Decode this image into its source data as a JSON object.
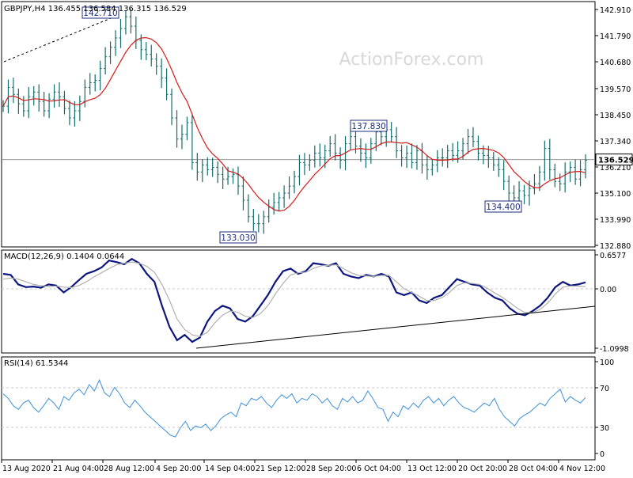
{
  "chart_data": [
    {
      "panel": "price",
      "type": "ohlc",
      "title": "GBPJPY,H4  136.455 136.584 136.315 136.529",
      "watermark": "ActionForex.com",
      "y_ticks": [
        "142.910",
        "141.790",
        "140.680",
        "139.570",
        "138.450",
        "137.340",
        "136.210",
        "135.100",
        "133.990",
        "132.880"
      ],
      "y_tick_values": [
        142.91,
        141.79,
        140.68,
        139.57,
        138.45,
        137.34,
        136.21,
        135.1,
        133.99,
        132.88
      ],
      "ylim": [
        132.88,
        142.91
      ],
      "current_price": 136.529,
      "current_price_label": "136.529",
      "annotations": [
        {
          "text": "142.710",
          "x": "28 Aug 2020",
          "y": 142.71
        },
        {
          "text": "133.030",
          "x": "21 Sep 2020",
          "y": 133.03
        },
        {
          "text": "137.830",
          "x": "6 Oct 2020",
          "y": 137.83
        },
        {
          "text": "134.400",
          "x": "29 Oct 2020",
          "y": 134.4
        }
      ],
      "series": [
        {
          "name": "price",
          "values": [
            138.8,
            139.6,
            139.3,
            138.9,
            138.6,
            139.2,
            139.4,
            139.0,
            138.6,
            139.1,
            139.4,
            139.2,
            138.7,
            138.3,
            138.6,
            139.0,
            139.6,
            139.8,
            139.9,
            140.4,
            140.9,
            141.3,
            141.7,
            142.1,
            142.6,
            142.2,
            141.6,
            141.2,
            141.0,
            140.8,
            140.5,
            140.0,
            139.3,
            138.3,
            137.4,
            137.6,
            138.1,
            136.4,
            136.0,
            136.3,
            136.1,
            136.2,
            135.9,
            135.7,
            135.8,
            135.9,
            135.4,
            134.8,
            134.1,
            133.8,
            133.8,
            134.1,
            134.5,
            134.7,
            134.9,
            135.1,
            135.4,
            135.8,
            136.4,
            136.3,
            136.5,
            136.8,
            136.6,
            136.9,
            137.2,
            136.8,
            136.5,
            137.2,
            137.5,
            137.1,
            136.8,
            136.6,
            137.2,
            137.7,
            137.5,
            137.8,
            137.5,
            136.9,
            136.6,
            136.8,
            136.4,
            136.9,
            136.3,
            136.1,
            136.3,
            136.6,
            136.6,
            136.9,
            136.7,
            136.9,
            137.2,
            137.5,
            137.3,
            136.8,
            136.7,
            136.6,
            136.3,
            136.1,
            135.6,
            135.1,
            134.9,
            135.2,
            135.0,
            135.3,
            135.5,
            136.0,
            137.0,
            136.1,
            135.6,
            135.5,
            136.0,
            136.2,
            135.7,
            136.1,
            136.5
          ]
        }
      ]
    },
    {
      "panel": "macd",
      "type": "line",
      "title": "MACD(12,26,9) 0.1404 0.0644",
      "y_ticks": [
        "0.6577",
        "0.00",
        "-1.0998"
      ],
      "y_tick_values": [
        0.6577,
        0,
        -1.0998
      ],
      "ylim": [
        -1.0998,
        0.6577
      ],
      "series": [
        {
          "name": "MACD",
          "values": [
            0.3,
            0.28,
            0.1,
            0.05,
            0.06,
            0.04,
            0.1,
            0.08,
            -0.05,
            0.05,
            0.18,
            0.3,
            0.35,
            0.42,
            0.55,
            0.52,
            0.48,
            0.58,
            0.5,
            0.3,
            0.15,
            -0.3,
            -0.7,
            -0.95,
            -0.85,
            -0.98,
            -0.9,
            -0.6,
            -0.4,
            -0.3,
            -0.35,
            -0.55,
            -0.6,
            -0.5,
            -0.3,
            -0.1,
            0.15,
            0.35,
            0.4,
            0.3,
            0.35,
            0.5,
            0.48,
            0.45,
            0.5,
            0.3,
            0.25,
            0.22,
            0.28,
            0.25,
            0.3,
            0.25,
            -0.05,
            -0.1,
            -0.05,
            -0.2,
            -0.25,
            -0.15,
            -0.1,
            0.05,
            0.2,
            0.15,
            0.1,
            0.08,
            -0.05,
            -0.15,
            -0.2,
            -0.35,
            -0.45,
            -0.48,
            -0.4,
            -0.3,
            -0.15,
            0.05,
            0.15,
            0.08,
            0.1,
            0.14
          ]
        },
        {
          "name": "Signal",
          "values": [
            0.2,
            0.22,
            0.2,
            0.15,
            0.1,
            0.08,
            0.06,
            0.07,
            0.05,
            0.04,
            0.08,
            0.15,
            0.24,
            0.32,
            0.4,
            0.47,
            0.5,
            0.52,
            0.5,
            0.44,
            0.33,
            0.1,
            -0.2,
            -0.55,
            -0.75,
            -0.85,
            -0.88,
            -0.8,
            -0.62,
            -0.48,
            -0.4,
            -0.42,
            -0.5,
            -0.52,
            -0.45,
            -0.3,
            -0.08,
            0.12,
            0.28,
            0.32,
            0.33,
            0.4,
            0.45,
            0.46,
            0.47,
            0.4,
            0.32,
            0.27,
            0.26,
            0.25,
            0.27,
            0.27,
            0.15,
            0.02,
            -0.05,
            -0.12,
            -0.2,
            -0.2,
            -0.15,
            -0.05,
            0.08,
            0.13,
            0.12,
            0.1,
            0.03,
            -0.06,
            -0.14,
            -0.24,
            -0.35,
            -0.43,
            -0.43,
            -0.37,
            -0.25,
            -0.08,
            0.05,
            0.07,
            0.07,
            0.06
          ]
        }
      ]
    },
    {
      "panel": "rsi",
      "type": "line",
      "title": "RSI(14) 61.5344",
      "y_ticks": [
        "100",
        "70",
        "30",
        "0"
      ],
      "y_tick_values": [
        100,
        70,
        30,
        0
      ],
      "ylim": [
        0,
        100
      ],
      "series": [
        {
          "name": "RSI",
          "values": [
            65,
            60,
            52,
            48,
            55,
            58,
            50,
            45,
            52,
            60,
            55,
            48,
            62,
            58,
            66,
            70,
            64,
            75,
            68,
            80,
            66,
            62,
            72,
            65,
            55,
            50,
            58,
            52,
            45,
            40,
            35,
            30,
            25,
            20,
            18,
            28,
            35,
            25,
            30,
            28,
            32,
            25,
            30,
            38,
            42,
            45,
            40,
            55,
            52,
            60,
            58,
            62,
            55,
            50,
            58,
            64,
            60,
            65,
            55,
            60,
            58,
            65,
            62,
            55,
            60,
            52,
            48,
            60,
            56,
            62,
            55,
            58,
            68,
            60,
            50,
            48,
            35,
            45,
            40,
            52,
            48,
            55,
            50,
            58,
            62,
            55,
            60,
            52,
            58,
            62,
            55,
            50,
            48,
            45,
            50,
            55,
            52,
            60,
            48,
            40,
            35,
            30,
            38,
            42,
            45,
            50,
            55,
            52,
            60,
            65,
            70,
            56,
            62,
            58,
            55,
            61
          ]
        }
      ]
    }
  ],
  "x_ticks": [
    "13 Aug 2020",
    "21 Aug 04:00",
    "28 Aug 12:00",
    "4 Sep 20:00",
    "14 Sep 04:00",
    "21 Sep 12:00",
    "28 Sep 20:00",
    "6 Oct 04:00",
    "13 Oct 12:00",
    "20 Oct 20:00",
    "28 Oct 04:00",
    "4 Nov 12:00"
  ],
  "colors": {
    "bar": "#146c6c",
    "ma": "#d11a1a",
    "macd": "#0b1680",
    "signal": "#b0b0b0",
    "rsi": "#3b8fd9",
    "trend": "#000000",
    "axis": "#000000",
    "grid": "#c8c8c8",
    "watermark": "#d8d8d8"
  }
}
